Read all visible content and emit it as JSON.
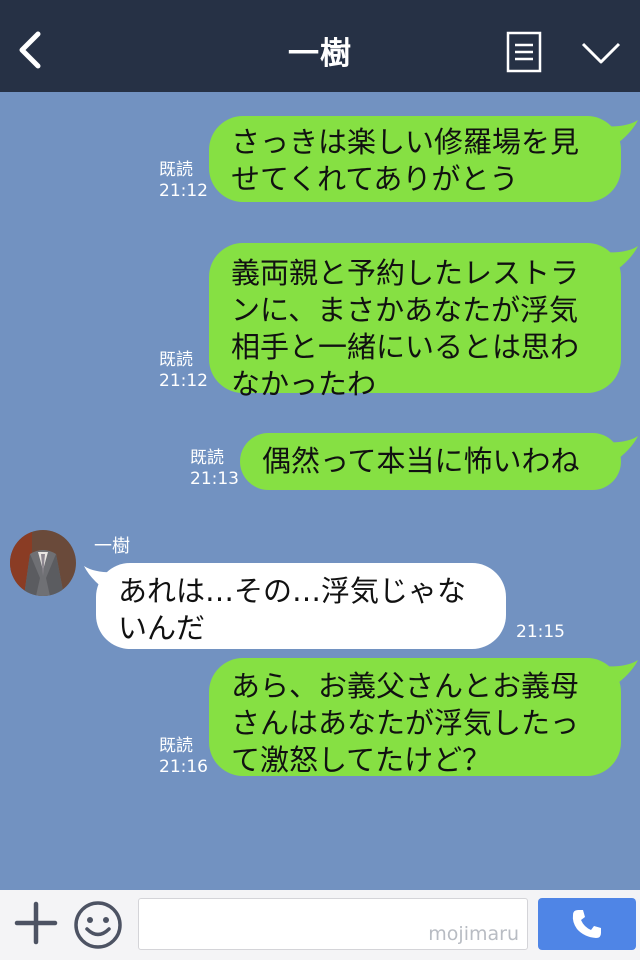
{
  "header": {
    "title": "一樹"
  },
  "messages": [
    {
      "side": "me",
      "lines": [
        "さっきは楽しい修羅場を見",
        "せてくれてありがとう"
      ],
      "read": "既読",
      "time": "21:12"
    },
    {
      "side": "me",
      "lines": [
        "義両親と予約したレストラ",
        "ンに、まさかあなたが浮気",
        "相手と一緒にいるとは思わ",
        "なかったわ"
      ],
      "read": "既読",
      "time": "21:12"
    },
    {
      "side": "me",
      "lines": [
        "偶然って本当に怖いわね"
      ],
      "read": "既読",
      "time": "21:13"
    },
    {
      "side": "them",
      "sender": "一樹",
      "lines": [
        "あれは…その…浮気じゃな",
        "いんだ"
      ],
      "time": "21:15"
    },
    {
      "side": "me",
      "lines": [
        "あら、お義父さんとお義母",
        "さんはあなたが浮気したっ",
        "て激怒してたけど？"
      ],
      "read": "既読",
      "time": "21:16"
    }
  ],
  "footer": {
    "watermark": "mojimaru"
  },
  "icons": {
    "back": "chevron-left-icon",
    "menu": "document-list-icon",
    "more": "chevron-down-icon",
    "add": "plus-icon",
    "emoji": "smile-icon",
    "call": "phone-icon"
  },
  "colors": {
    "header": "#263145",
    "background": "#7292c1",
    "my_bubble": "#86e043",
    "their_bubble": "#ffffff",
    "call_button": "#4f85e6"
  }
}
